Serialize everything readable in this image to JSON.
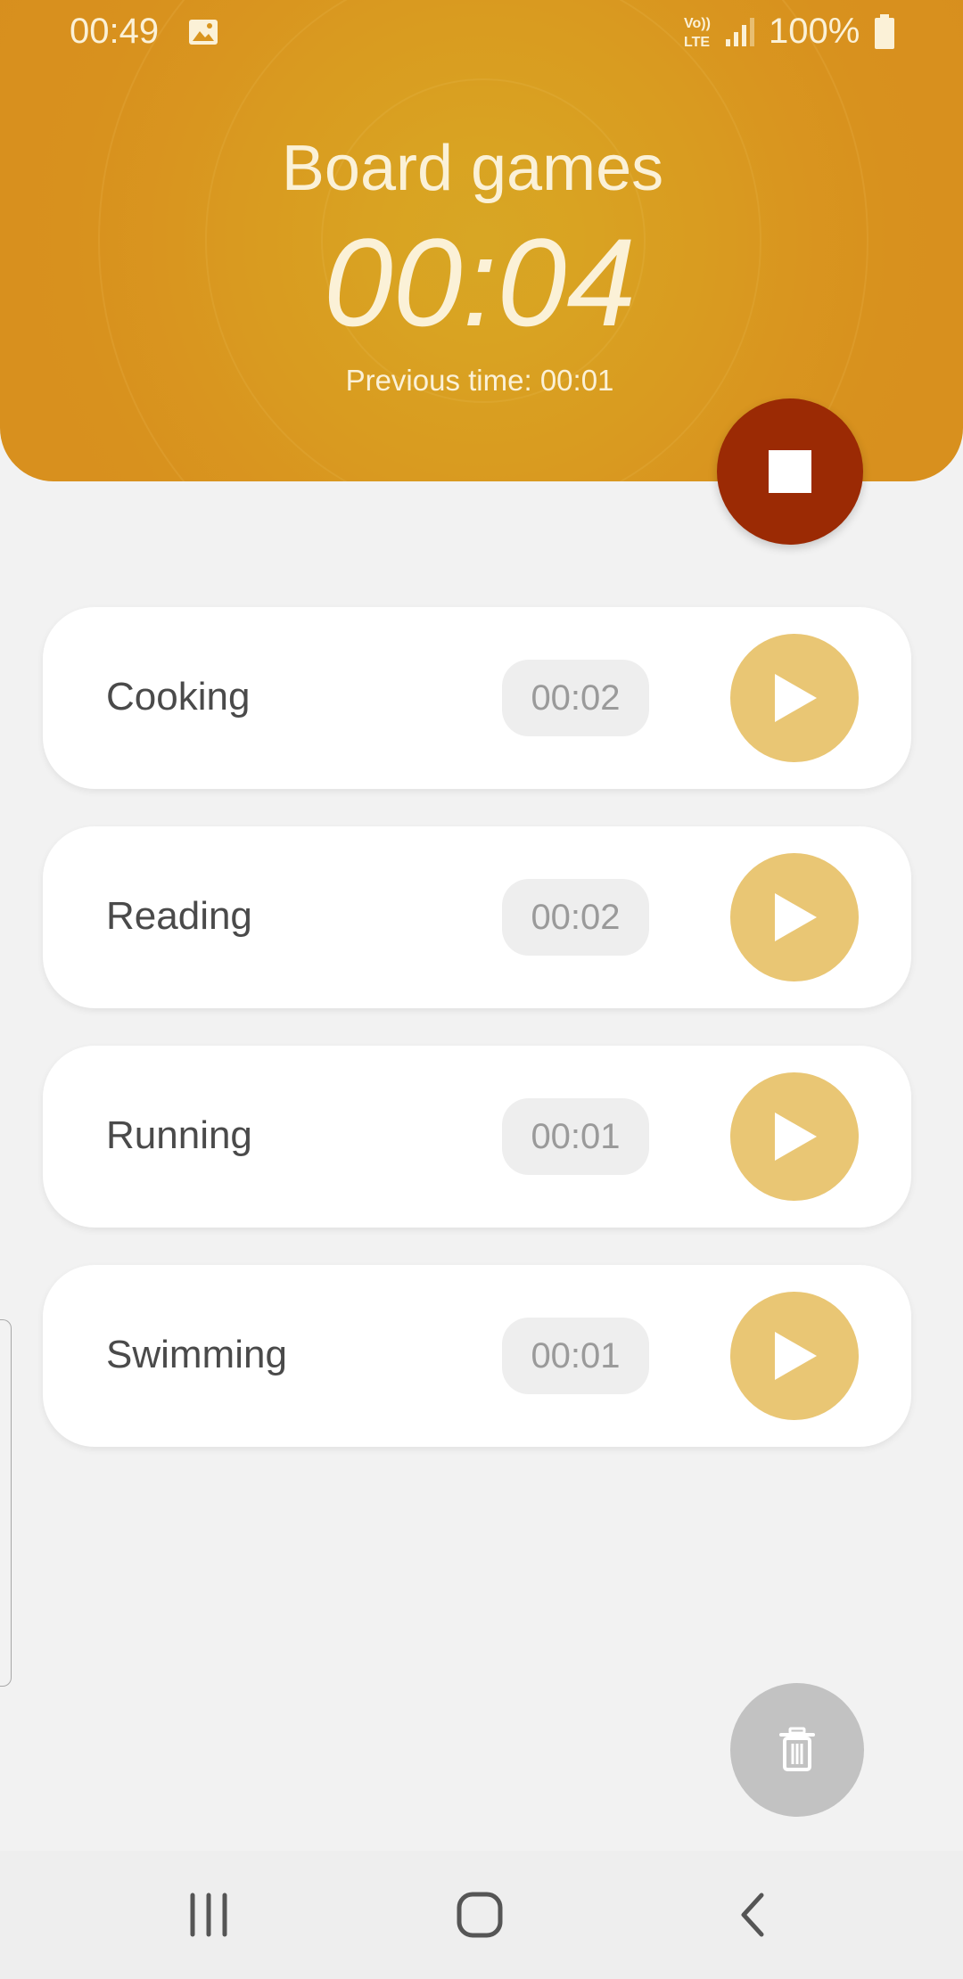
{
  "status_bar": {
    "time": "00:49",
    "battery": "100%",
    "icons": [
      "image-icon",
      "volte-icon",
      "signal-icon",
      "battery-icon"
    ]
  },
  "active_activity": {
    "title": "Board games",
    "timer": "00:04",
    "previous_time": "Previous time: 00:01"
  },
  "activities": [
    {
      "name": "Cooking",
      "time": "00:02"
    },
    {
      "name": "Reading",
      "time": "00:02"
    },
    {
      "name": "Running",
      "time": "00:01"
    },
    {
      "name": "Swimming",
      "time": "00:01"
    }
  ],
  "icons": {
    "stop": "stop-icon",
    "play": "play-icon",
    "delete": "trash-icon",
    "nav": [
      "recent-apps-icon",
      "home-icon",
      "back-icon"
    ]
  },
  "colors": {
    "header_gold": "#d9951f",
    "stop_red": "#9b2a04",
    "play_gold": "#e9c674",
    "delete_gray": "#c2c2c2",
    "background": "#f2f2f2"
  }
}
